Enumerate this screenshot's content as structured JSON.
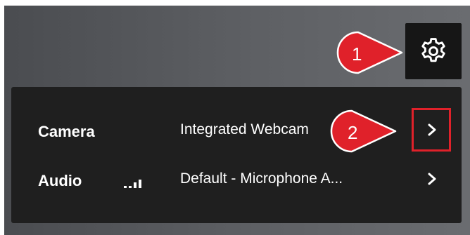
{
  "settings_button": {
    "icon": "gear-icon"
  },
  "devices": {
    "camera": {
      "label": "Camera",
      "value": "Integrated Webcam"
    },
    "audio": {
      "label": "Audio",
      "value": "Default - Microphone A...",
      "level_bars": 4
    }
  },
  "callouts": [
    {
      "number": "1",
      "color": "#e0212a"
    },
    {
      "number": "2",
      "color": "#e0212a"
    }
  ],
  "colors": {
    "panel": "#1f1f1f",
    "button": "#161616",
    "annotation": "#e0212a"
  }
}
